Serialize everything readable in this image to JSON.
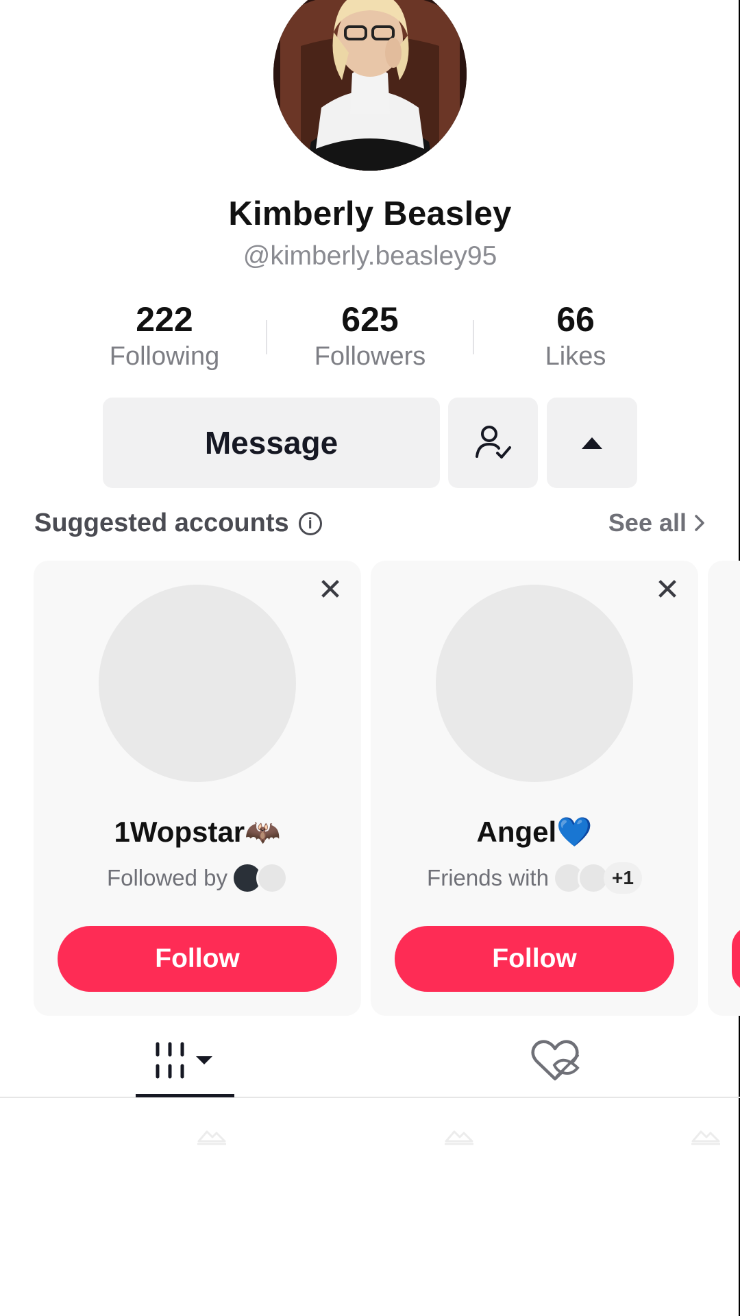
{
  "profile": {
    "display_name": "Kimberly Beasley",
    "username": "@kimberly.beasley95",
    "avatar_icon": "profile-photo"
  },
  "stats": [
    {
      "value": "222",
      "label": "Following"
    },
    {
      "value": "625",
      "label": "Followers"
    },
    {
      "value": "66",
      "label": "Likes"
    }
  ],
  "actions": {
    "message_label": "Message",
    "friends_icon": "person-check-icon",
    "more_icon": "caret-up-icon"
  },
  "suggested": {
    "title": "Suggested accounts",
    "see_all": "See all",
    "cards": [
      {
        "name": "1Wopstar🦇",
        "relation": "Followed by",
        "follow_label": "Follow"
      },
      {
        "name": "Angel💙",
        "relation": "Friends with",
        "extra_count": "+1",
        "follow_label": "Follow"
      }
    ]
  },
  "tabs": {
    "videos_icon": "grid-icon",
    "liked_icon": "hidden-heart-icon"
  },
  "colors": {
    "accent": "#fe2c55",
    "button_bg": "#f1f1f2",
    "card_bg": "#f8f8f8"
  }
}
